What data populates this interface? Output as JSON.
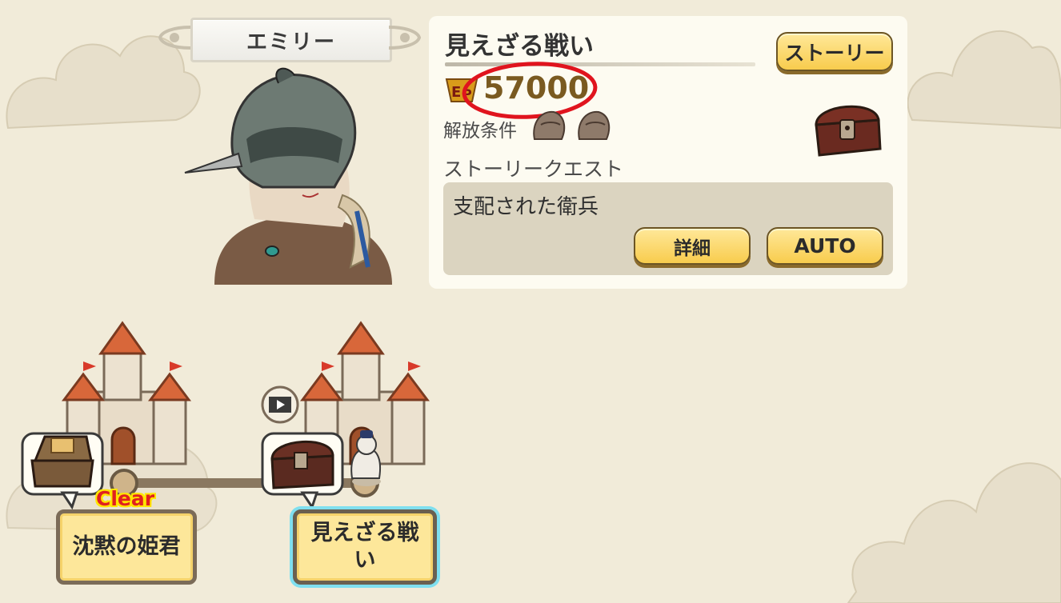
{
  "character": {
    "name": "エミリー"
  },
  "quest": {
    "title": "見えざる戦い",
    "story_button": "ストーリー",
    "ep_value": "57000",
    "unlock_label": "解放条件",
    "story_quest_label": "ストーリークエスト",
    "story_quest_name": "支配された衛兵",
    "detail_button": "詳細",
    "auto_button": "AUTO"
  },
  "map": {
    "nodes": [
      {
        "label": "沈黙の姫君",
        "status": "Clear"
      },
      {
        "label": "見えざる戦\nい"
      }
    ]
  },
  "colors": {
    "accent": "#f8cc4d",
    "highlight": "#7fdfef",
    "annotation": "#e0141e"
  },
  "icons": [
    "ep-icon",
    "hood-icon",
    "treasure-chest-icon",
    "open-chest-icon",
    "video-icon",
    "castle-icon",
    "knight-piece-icon"
  ]
}
